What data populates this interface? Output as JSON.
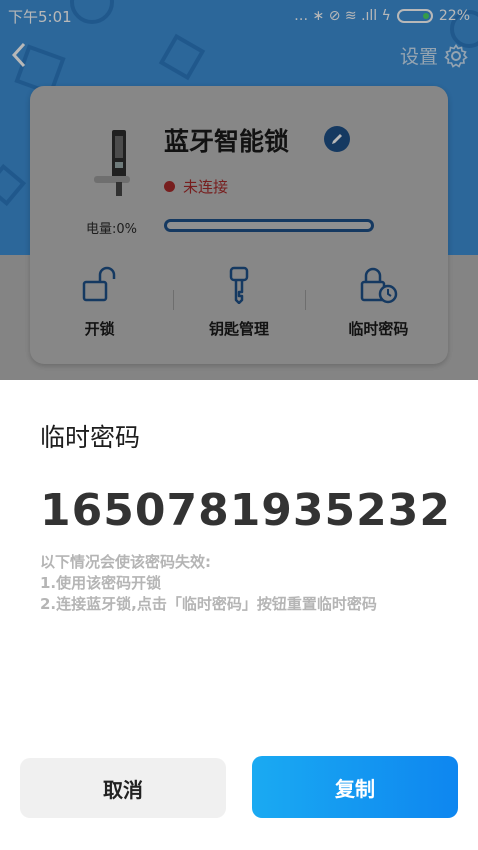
{
  "status_bar": {
    "time": "下午5:01",
    "indicators": "… ∗ ⊘ ≋ .ıll ϟ",
    "battery_percent": "22%"
  },
  "nav": {
    "back_icon": "back-arrow-icon",
    "settings_label": "设置",
    "settings_icon": "gear-icon"
  },
  "device": {
    "name": "蓝牙智能锁",
    "connection_status": "未连接",
    "battery_label": "电量:0%",
    "battery_level": 0
  },
  "actions": [
    {
      "label": "开锁",
      "icon": "unlock-icon"
    },
    {
      "label": "钥匙管理",
      "icon": "key-icon"
    },
    {
      "label": "临时密码",
      "icon": "lock-clock-icon"
    }
  ],
  "sheet": {
    "title": "临时密码",
    "code": "1650781935232",
    "notice_lines": [
      "以下情况会使该密码失效:",
      "1.使用该密码开锁",
      "2.连接蓝牙锁,点击「临时密码」按钮重置临时密码"
    ],
    "cancel_label": "取消",
    "copy_label": "复制"
  },
  "colors": {
    "header_blue": "#3d8fd6",
    "primary_dark_blue": "#1e4f87",
    "disconnected_red": "#a52a2a",
    "copy_button": "#0e86f0"
  }
}
